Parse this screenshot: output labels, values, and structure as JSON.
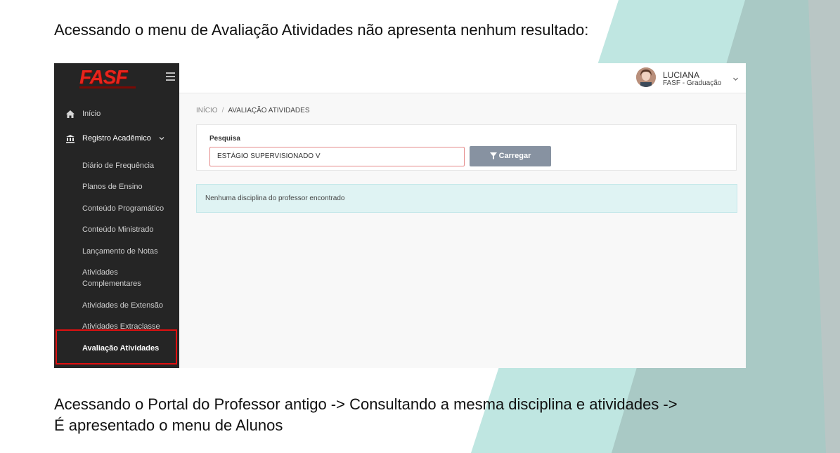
{
  "slide": {
    "heading": "Acessando o menu de Avaliação Atividades não apresenta nenhum resultado:",
    "footer_line1": "Acessando o Portal do Professor antigo -> Consultando a mesma disciplina e atividades ->",
    "footer_line2": "É apresentado o menu de Alunos"
  },
  "app": {
    "logo": "FASF",
    "colors": {
      "sidebar_bg": "#252525",
      "brand_red": "#e8241c",
      "alert_bg": "#dff3f3",
      "button_bg": "#8792a1",
      "highlight": "#e01010"
    },
    "sidebar": {
      "inicio": "Início",
      "registro": "Registro Acadêmico",
      "items": [
        "Diário de Frequência",
        "Planos de Ensino",
        "Conteúdo Programático",
        "Conteúdo Ministrado",
        "Lançamento de Notas",
        "Atividades Complementares",
        "Atividades de Extensão",
        "Atividades Extraclasse",
        "Avaliação Atividades"
      ]
    },
    "user": {
      "name": "LUCIANA",
      "org": "FASF - Graduação"
    },
    "breadcrumb": {
      "home": "INÍCIO",
      "separator": "/",
      "current": "AVALIAÇÃO ATIVIDADES"
    },
    "search": {
      "label": "Pesquisa",
      "value": "ESTÁGIO SUPERVISIONADO V"
    },
    "load_button": "Carregar",
    "alert": "Nenhuma disciplina do professor encontrado"
  }
}
